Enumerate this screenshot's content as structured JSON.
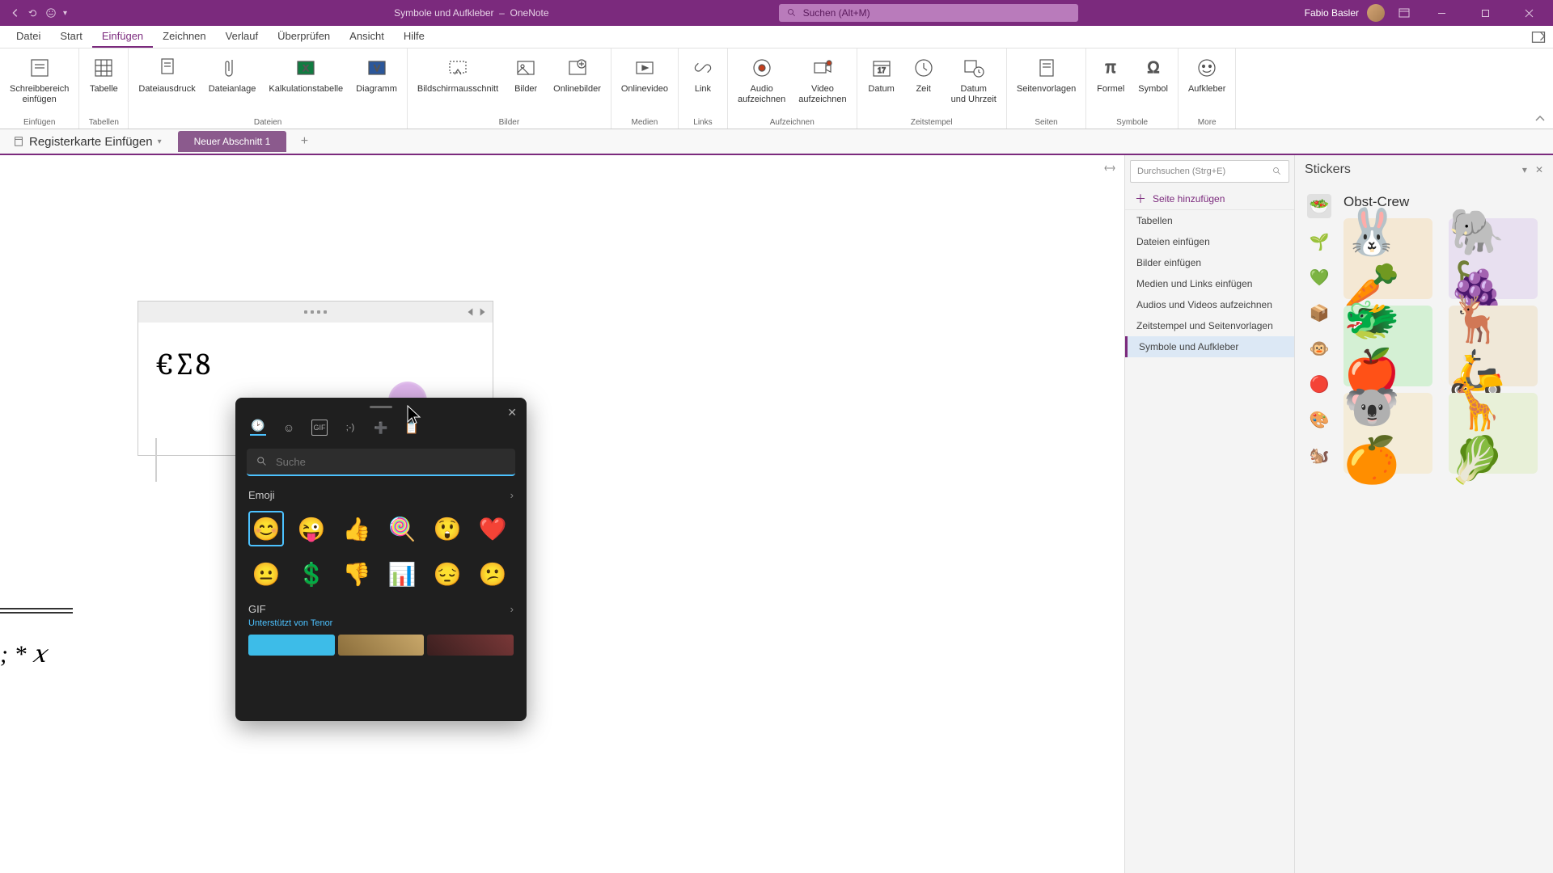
{
  "titlebar": {
    "doc": "Symbole und Aufkleber",
    "app": "OneNote",
    "search_placeholder": "Suchen (Alt+M)",
    "user": "Fabio Basler"
  },
  "menu": {
    "tabs": [
      "Datei",
      "Start",
      "Einfügen",
      "Zeichnen",
      "Verlauf",
      "Überprüfen",
      "Ansicht",
      "Hilfe"
    ],
    "active": 2
  },
  "ribbon": {
    "groups": [
      {
        "label": "Einfügen",
        "items": [
          {
            "name": "Schreibbereich einfügen"
          }
        ]
      },
      {
        "label": "Tabellen",
        "items": [
          {
            "name": "Tabelle"
          }
        ]
      },
      {
        "label": "Dateien",
        "items": [
          {
            "name": "Dateiausdruck"
          },
          {
            "name": "Dateianlage"
          },
          {
            "name": "Kalkulationstabelle"
          },
          {
            "name": "Diagramm"
          }
        ]
      },
      {
        "label": "Bilder",
        "items": [
          {
            "name": "Bildschirmausschnitt"
          },
          {
            "name": "Bilder"
          },
          {
            "name": "Onlinebilder"
          }
        ]
      },
      {
        "label": "Medien",
        "items": [
          {
            "name": "Onlinevideo"
          }
        ]
      },
      {
        "label": "Links",
        "items": [
          {
            "name": "Link"
          }
        ]
      },
      {
        "label": "Aufzeichnen",
        "items": [
          {
            "name": "Audio aufzeichnen"
          },
          {
            "name": "Video aufzeichnen"
          }
        ]
      },
      {
        "label": "Zeitstempel",
        "items": [
          {
            "name": "Datum"
          },
          {
            "name": "Zeit"
          },
          {
            "name": "Datum und Uhrzeit"
          }
        ]
      },
      {
        "label": "Seiten",
        "items": [
          {
            "name": "Seitenvorlagen"
          }
        ]
      },
      {
        "label": "Symbole",
        "items": [
          {
            "name": "Formel"
          },
          {
            "name": "Symbol"
          }
        ]
      },
      {
        "label": "More",
        "items": [
          {
            "name": "Aufkleber"
          }
        ]
      }
    ]
  },
  "notebook": {
    "name": "Registerkarte Einfügen",
    "section": "Neuer Abschnitt 1"
  },
  "note": {
    "content": "€∑8"
  },
  "math": {
    "expr": "; * 𝑥"
  },
  "pages": {
    "search_placeholder": "Durchsuchen (Strg+E)",
    "add": "Seite hinzufügen",
    "items": [
      "Tabellen",
      "Dateien einfügen",
      "Bilder einfügen",
      "Medien und Links einfügen",
      "Audios und Videos aufzeichnen",
      "Zeitstempel und Seitenvorlagen",
      "Symbole und Aufkleber"
    ],
    "active": 6
  },
  "stickers": {
    "title": "Stickers",
    "set": "Obst-Crew",
    "cats": [
      "🥗",
      "🌱",
      "💚",
      "📦",
      "🐵",
      "🔴",
      "🎨",
      "🐿️"
    ]
  },
  "emoji": {
    "search_placeholder": "Suche",
    "section": "Emoji",
    "row1": [
      "😊",
      "😜",
      "👍",
      "🍭",
      "😲",
      "❤️"
    ],
    "row2": [
      "😐",
      "💲",
      "👎",
      "📊",
      "😔",
      "😕"
    ],
    "gif": "GIF",
    "gif_sub": "Unterstützt von Tenor"
  }
}
